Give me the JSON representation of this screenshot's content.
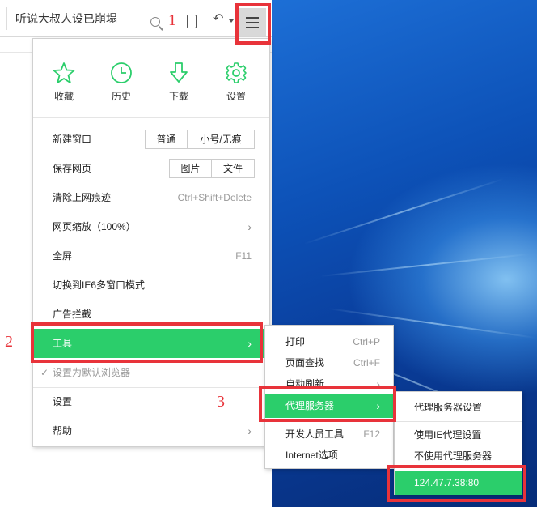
{
  "toolbar": {
    "address_text": "听说大叔人设已崩塌"
  },
  "quick_actions": [
    {
      "label": "收藏",
      "icon": "star-icon"
    },
    {
      "label": "历史",
      "icon": "clock-icon"
    },
    {
      "label": "下载",
      "icon": "download-icon"
    },
    {
      "label": "设置",
      "icon": "gear-icon"
    }
  ],
  "menu": {
    "new_window": {
      "label": "新建窗口",
      "options": [
        "普通",
        "小号/无痕"
      ]
    },
    "save_page": {
      "label": "保存网页",
      "options": [
        "图片",
        "文件"
      ]
    },
    "clear_history": {
      "label": "清除上网痕迹",
      "shortcut": "Ctrl+Shift+Delete"
    },
    "zoom": {
      "label": "网页缩放（100%）"
    },
    "fullscreen": {
      "label": "全屏",
      "shortcut": "F11"
    },
    "ie6_mode": {
      "label": "切换到IE6多窗口模式"
    },
    "ad_block": {
      "label": "广告拦截"
    },
    "tools": {
      "label": "工具"
    },
    "default_browser": {
      "label": "设置为默认浏览器"
    },
    "settings": {
      "label": "设置"
    },
    "help": {
      "label": "帮助"
    }
  },
  "tools_submenu": [
    {
      "label": "打印",
      "shortcut": "Ctrl+P"
    },
    {
      "label": "页面查找",
      "shortcut": "Ctrl+F"
    },
    {
      "label": "自动刷新",
      "shortcut": ""
    },
    {
      "label": "代理服务器",
      "shortcut": ""
    },
    {
      "label": "开发人员工具",
      "shortcut": "F12"
    },
    {
      "label": "Internet选项",
      "shortcut": ""
    }
  ],
  "proxy_submenu": [
    {
      "label": "代理服务器设置"
    },
    {
      "label": "使用IE代理设置"
    },
    {
      "label": "不使用代理服务器"
    },
    {
      "label": "124.47.7.38:80"
    }
  ],
  "annotations": {
    "n1": "1",
    "n2": "2",
    "n3": "3",
    "color": "#e8333a"
  },
  "colors": {
    "accent_green": "#2bce6b",
    "desktop_blue": "#0d52b8"
  }
}
